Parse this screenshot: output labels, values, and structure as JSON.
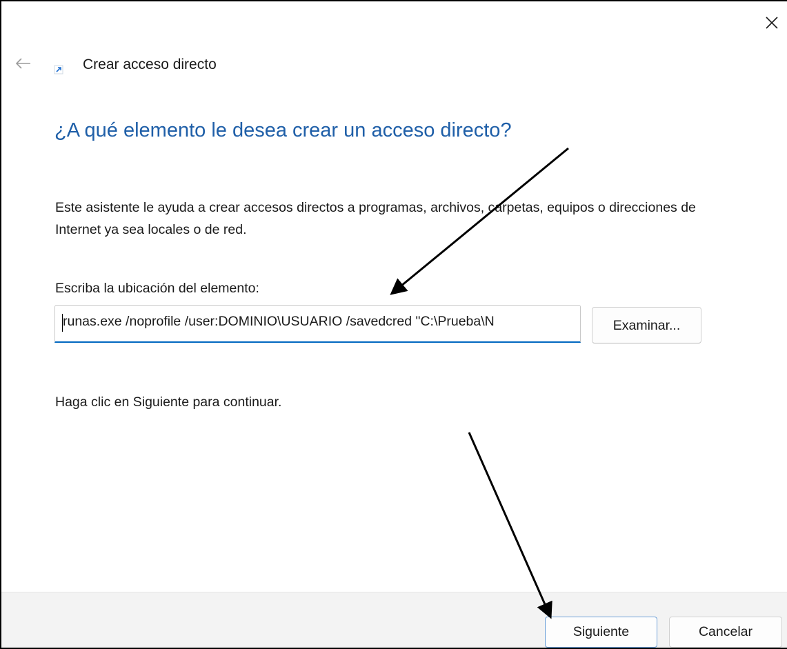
{
  "window": {
    "title": "Crear acceso directo",
    "close_icon": "close-icon",
    "back_icon": "back-arrow-icon",
    "title_icon": "shortcut-icon"
  },
  "main": {
    "heading": "¿A qué elemento le desea crear un acceso directo?",
    "description": "Este asistente le ayuda a crear accesos directos a programas, archivos, carpetas, equipos o direcciones de Internet ya sea locales o de red.",
    "location_label": "Escriba la ubicación del elemento:",
    "location_value": "runas.exe /noprofile /user:DOMINIO\\USUARIO /savedcred \"C:\\Prueba\\N",
    "browse_label": "Examinar...",
    "continue_hint": "Haga clic en Siguiente para continuar."
  },
  "footer": {
    "next_label": "Siguiente",
    "cancel_label": "Cancelar"
  },
  "colors": {
    "heading": "#1f5fa8",
    "accent": "#0067c0",
    "footer_bg": "#f3f3f3",
    "annotation_arrow": "#000000"
  }
}
